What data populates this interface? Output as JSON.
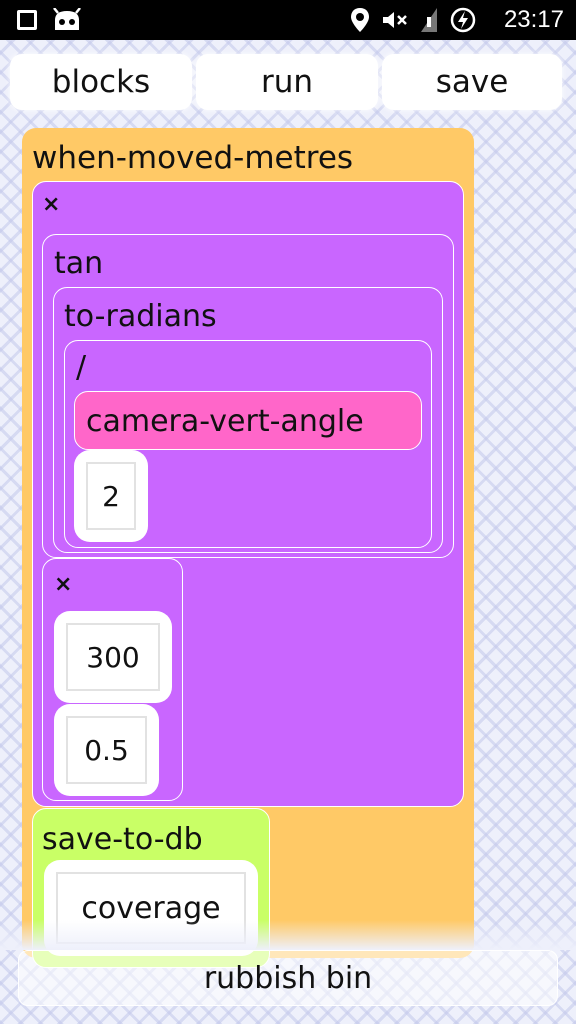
{
  "status_bar": {
    "time": "23:17",
    "icons": [
      "square-icon",
      "android-robot-icon",
      "location-icon",
      "mute-icon",
      "signal-icon",
      "battery-charging-icon"
    ]
  },
  "toolbar": {
    "blocks_label": "blocks",
    "run_label": "run",
    "save_label": "save"
  },
  "program": {
    "event_label": "when-moved-metres",
    "multiply_outer_label": "×",
    "tan_label": "tan",
    "to_radians_label": "to-radians",
    "divide_label": "/",
    "camera_label": "camera-vert-angle",
    "divisor_value": "2",
    "multiply_inner_label": "×",
    "factor_a_value": "300",
    "factor_b_value": "0.5",
    "save_to_db_label": "save-to-db",
    "db_field_value": "coverage"
  },
  "rubbish_bin_label": "rubbish bin",
  "colors": {
    "event_block": "#ffc966",
    "math_block": "#c966ff",
    "sensor_block": "#ff66c9",
    "db_block": "#c9ff66"
  }
}
